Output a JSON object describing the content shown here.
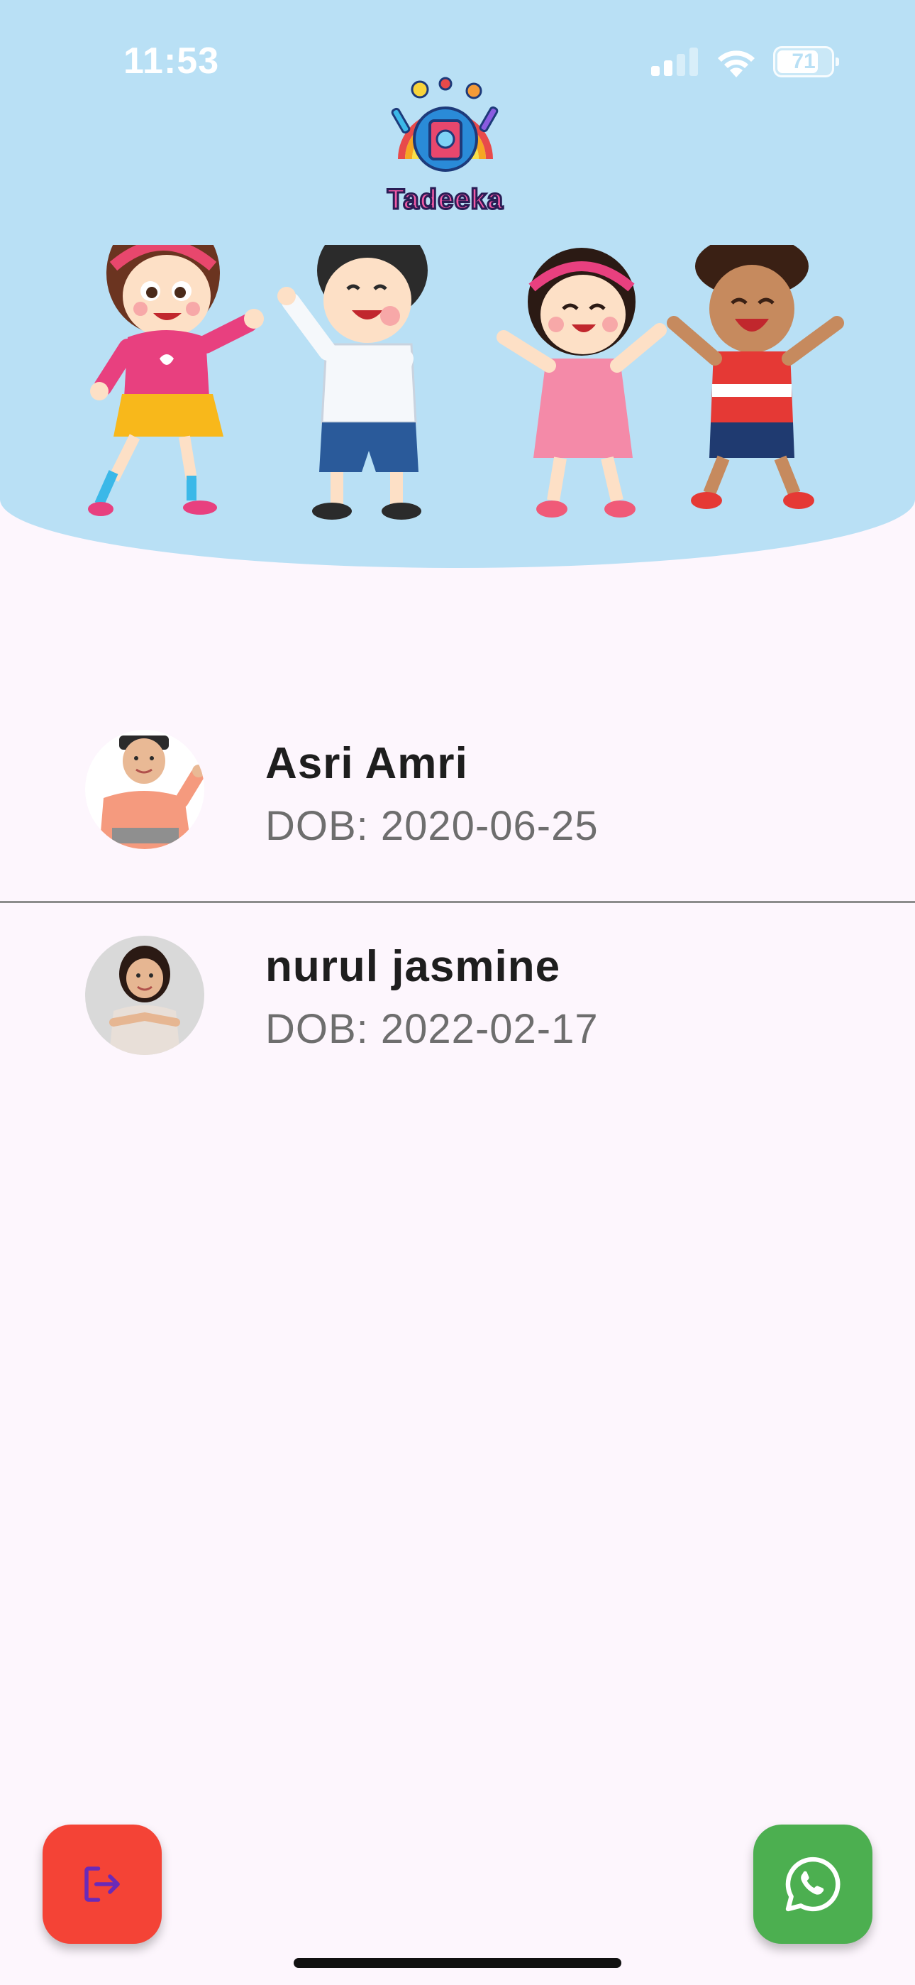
{
  "status_bar": {
    "time": "11:53",
    "battery": "71",
    "battery_level_percent": 71,
    "signal_icon": "cellular-signal-icon",
    "wifi_icon": "wifi-icon"
  },
  "header": {
    "brand": "Tadeeka",
    "background_color": "#b9e0f5"
  },
  "children": [
    {
      "name": "Asri Amri",
      "dob": "DOB: 2020-06-25"
    },
    {
      "name": "nurul jasmine",
      "dob": "DOB: 2022-02-17"
    }
  ],
  "actions": {
    "logout_icon": "logout-icon",
    "logout_color": "#f44336",
    "whatsapp_icon": "whatsapp-icon",
    "whatsapp_color": "#4caf50"
  }
}
